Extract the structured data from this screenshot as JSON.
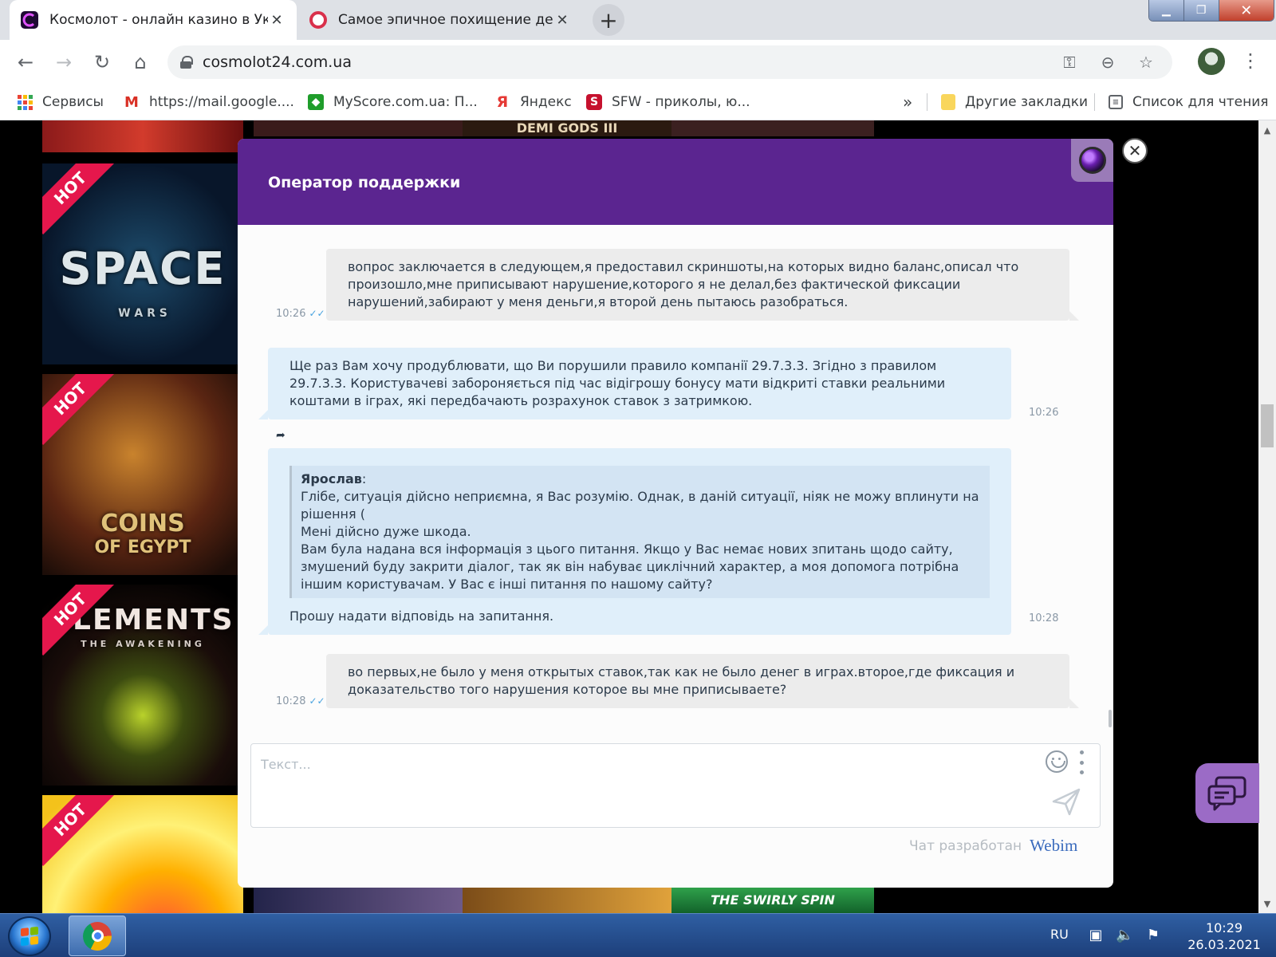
{
  "browser": {
    "tabs": [
      {
        "title": "Космолот - онлайн казино в Україні",
        "favicon_color": "#1e0a33"
      },
      {
        "title": "Самое эпичное похищение денег",
        "favicon_color": "#d9304b"
      }
    ],
    "close_glyph": "✕",
    "new_tab_glyph": "+",
    "window_controls": {
      "minimize": "▁",
      "maximize": "❐",
      "close": "✕"
    },
    "url": "cosmolot24.com.ua",
    "nav_glyphs": {
      "back": "←",
      "forward": "→",
      "reload": "↻",
      "home": "⌂"
    },
    "omnibox_icons": {
      "key": "⚿",
      "zoom": "⊖",
      "star": "☆"
    },
    "menu_glyph": "⋮",
    "bookmarks": [
      {
        "label": "Сервисы",
        "icon": "apps-icon"
      },
      {
        "label": "https://mail.google....",
        "icon": "gmail-icon",
        "icon_glyph": "M",
        "color": "#d93025"
      },
      {
        "label": "MyScore.com.ua: П...",
        "icon": "myscore-icon",
        "icon_glyph": "◆",
        "color": "#1f9d2b"
      },
      {
        "label": "Яндекс",
        "icon": "yandex-icon",
        "icon_glyph": "Я",
        "color": "#e53935"
      },
      {
        "label": "SFW - приколы, ю...",
        "icon": "sfw-icon",
        "icon_glyph": "S",
        "color": "#c6112e"
      }
    ],
    "bookmarks_overflow": "»",
    "other_bookmarks": "Другие закладки",
    "reading_list": "Список для чтения"
  },
  "page": {
    "thumbnails": [
      {
        "badge": "HOT",
        "title": "SPACE",
        "subtitle": "W A R S"
      },
      {
        "badge": "HOT",
        "title": "COINS",
        "subtitle": "OF EGYPT"
      },
      {
        "badge": "HOT",
        "title": "ELEMENTS",
        "subtitle": "THE AWAKENING"
      },
      {
        "badge": "HOT",
        "title": "",
        "subtitle": ""
      }
    ],
    "top_strip_text": "DEMI GODS III",
    "bottom_strip_text": "THE SWIRLY SPIN"
  },
  "chat": {
    "title": "Оператор поддержки",
    "close_glyph": "✕",
    "messages": [
      {
        "direction": "out",
        "time": "10:26",
        "read_mark": "✓✓",
        "text": "вопрос заключается в следующем,я предоставил скриншоты,на которых видно баланс,описал что произошло,мне приписывают нарушение,которого я не делал,без фактической фиксации нарушений,забирают у меня деньги,я второй день пытаюсь разобраться."
      },
      {
        "direction": "in",
        "time": "10:26",
        "text": "Ще раз Вам хочу продублювати, що Ви порушили правило компанії 29.7.3.3. Згідно з правилом 29.7.3.3. Користувачеві забороняється під час відігрошу бонусу мати відкриті ставки реальними коштами в іграх, які передбачають розрахунок ставок з затримкою."
      },
      {
        "direction": "in",
        "time": "10:28",
        "reply_glyph": "➦",
        "quote_author": "Ярослав",
        "quote_lines": [
          "Глібе, ситуація дійсно неприємна, я Вас розумію. Однак, в даній ситуації, ніяк не можу вплинути на рішення (",
          "Мені дійсно дуже шкода.",
          "Вам була надана вся інформація з цього питання. Якщо у Вас немає нових зпитань щодо сайту, змушений буду закрити діалог, так як він набуває циклічний характер, а моя допомога потрібна іншим користувачам. У Вас є інші питання по нашому сайту?"
        ],
        "text": "Прошу надати відповідь на запитання."
      },
      {
        "direction": "out",
        "time": "10:28",
        "read_mark": "✓✓",
        "text": "во первых,не было у меня открытых ставок,так как не было денег в играх.второе,где фиксация и доказательство того нарушения которое вы мне приписываете?"
      }
    ],
    "input_placeholder": "Текст...",
    "powered_by": "Чат разработан",
    "brand": "Webim"
  },
  "taskbar": {
    "language": "RU",
    "time": "10:29",
    "date": "26.03.2021"
  },
  "colors": {
    "chat_header": "#5b2590",
    "bubble_out": "#ececec",
    "bubble_in": "#e0effa",
    "hot_badge": "#e5174c"
  }
}
